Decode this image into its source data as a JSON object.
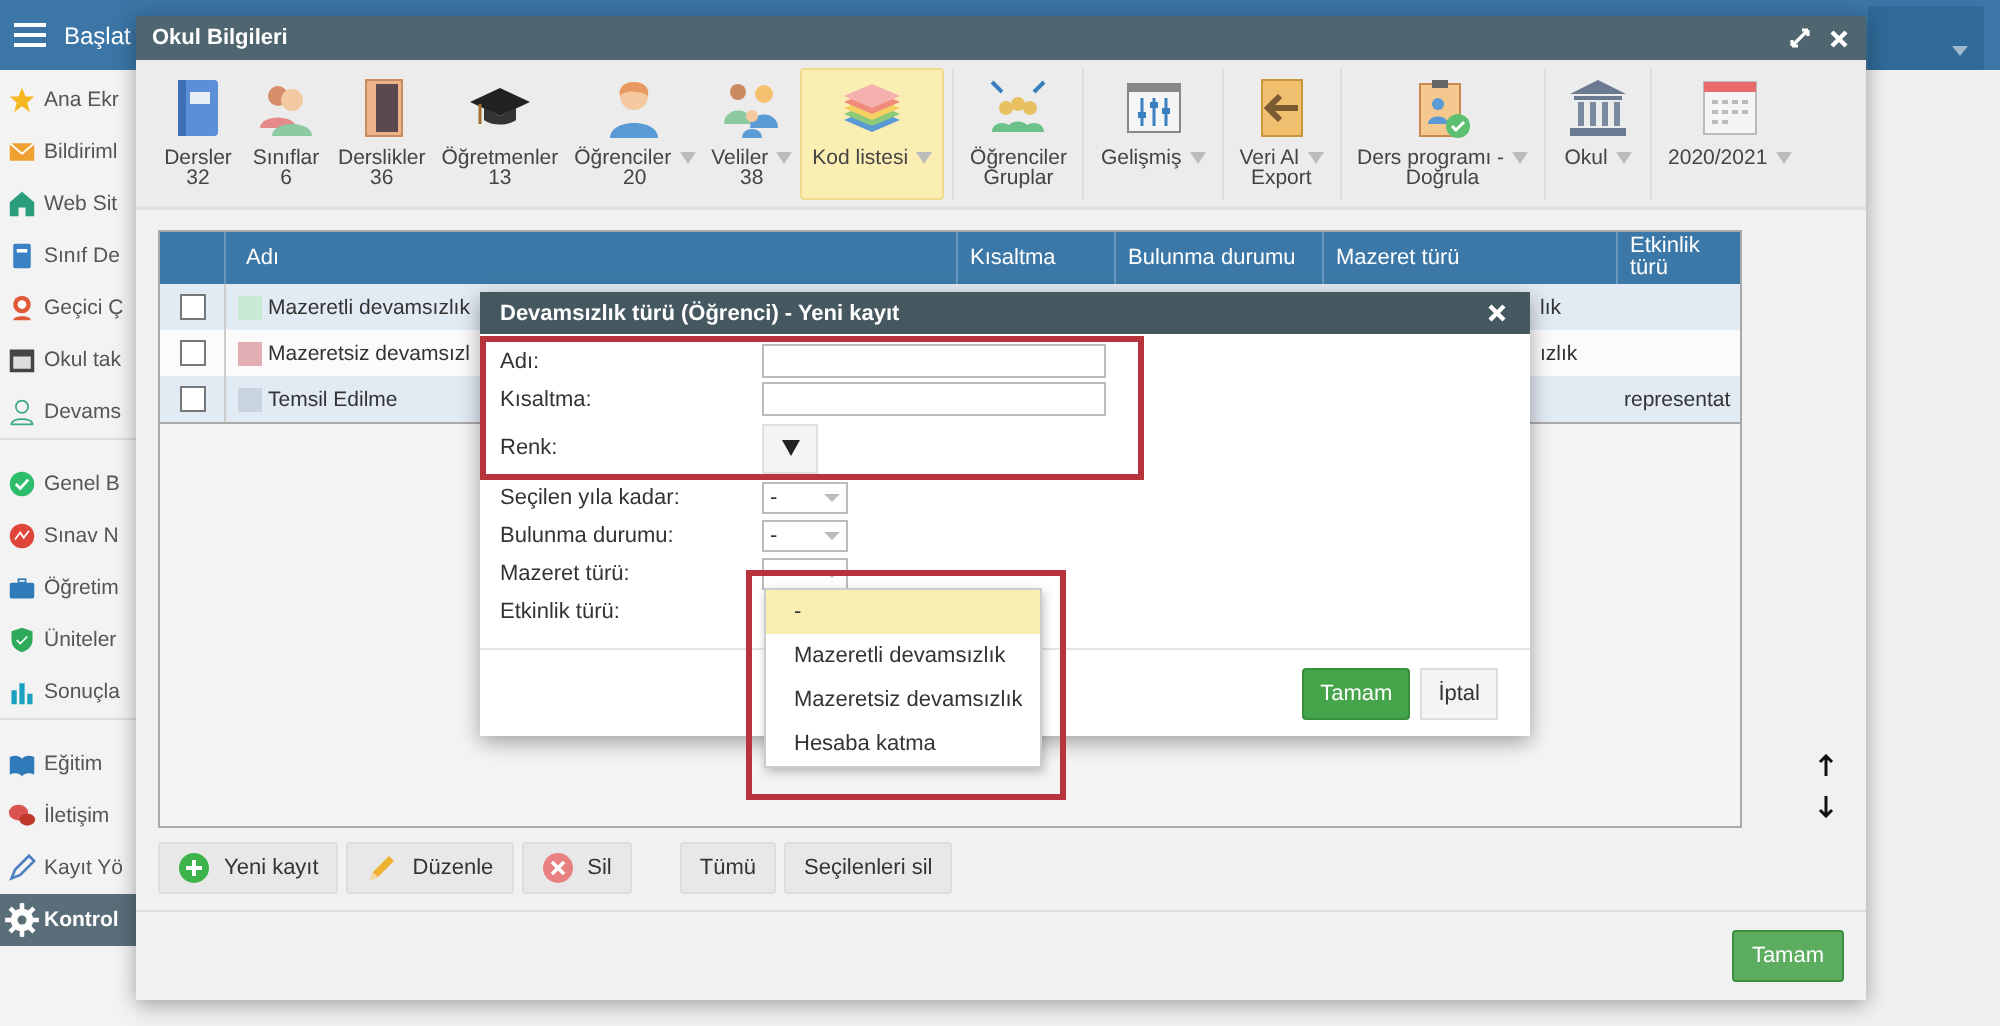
{
  "topbar": {
    "title": "Başlat"
  },
  "sidebar": {
    "groups": [
      [
        {
          "label": "Ana Ekr",
          "selected": false
        },
        {
          "label": "Bildiriml",
          "selected": false
        },
        {
          "label": "Web Sit",
          "selected": false
        },
        {
          "label": "Sınıf De",
          "selected": false
        },
        {
          "label": "Geçici Ç",
          "selected": false
        },
        {
          "label": "Okul tak",
          "selected": false
        },
        {
          "label": "Devams",
          "selected": false
        }
      ],
      [
        {
          "label": "Genel B",
          "selected": false
        },
        {
          "label": "Sınav N",
          "selected": false
        },
        {
          "label": "Öğretim",
          "selected": false
        },
        {
          "label": "Üniteler",
          "selected": false
        },
        {
          "label": "Sonuçla",
          "selected": false
        }
      ],
      [
        {
          "label": "Eğitim",
          "selected": false
        },
        {
          "label": "İletişim",
          "selected": false
        },
        {
          "label": "Kayıt Yö",
          "selected": false
        },
        {
          "label": "Kontrol",
          "selected": true
        }
      ]
    ]
  },
  "window": {
    "title": "Okul Bilgileri"
  },
  "toolbar": {
    "groups": [
      [
        {
          "label": "Dersler",
          "second_line": "32",
          "dropdown": false,
          "selected": false
        },
        {
          "label": "Sınıflar",
          "second_line": "6",
          "dropdown": false,
          "selected": false
        },
        {
          "label": "Derslikler",
          "second_line": "36",
          "dropdown": false,
          "selected": false
        },
        {
          "label": "Öğretmenler",
          "second_line": "13",
          "dropdown": false,
          "selected": false
        },
        {
          "label": "Öğrenciler",
          "second_line": "20",
          "dropdown": true,
          "selected": false
        },
        {
          "label": "Veliler",
          "second_line": "38",
          "dropdown": true,
          "selected": false
        },
        {
          "label": "Kod listesi",
          "dropdown": true,
          "selected": true
        }
      ],
      [
        {
          "label": "Öğrenciler",
          "second_line": "Gruplar",
          "dropdown": false,
          "selected": false
        }
      ],
      [
        {
          "label": "Gelişmiş",
          "dropdown": true,
          "selected": false
        }
      ],
      [
        {
          "label": "Veri Al",
          "second_line": "Export",
          "dropdown": true,
          "selected": false
        }
      ],
      [
        {
          "label": "Ders programı -",
          "second_line": "Doğrula",
          "dropdown": true,
          "selected": false
        }
      ],
      [
        {
          "label": "Okul",
          "dropdown": true,
          "selected": false
        }
      ],
      [
        {
          "label": "2020/2021",
          "dropdown": true,
          "selected": false
        }
      ]
    ]
  },
  "table": {
    "columns": [
      "Adı",
      "Kısaltma",
      "Bulunma durumu",
      "Mazeret türü",
      "Etkinlik türü"
    ],
    "rows": [
      {
        "checked": false,
        "color": "#c8ead4",
        "name": "Mazeretli devamsızlık",
        "mazeret_turu": "lık"
      },
      {
        "checked": false,
        "color": "#e2aeb4",
        "name": "Mazeretsiz devamsızl",
        "mazeret_turu": "ızlık"
      },
      {
        "checked": false,
        "color": "#c8d4de",
        "name": "Temsil Edilme",
        "etkinlik_turu": "representat"
      }
    ]
  },
  "buttons": {
    "edit_actions": [
      "Yeni kayıt",
      "Düzenle",
      "Sil"
    ],
    "selection_actions": [
      "Tümü",
      "Seçilenleri sil"
    ]
  },
  "footer": {
    "ok": "Tamam"
  },
  "dialog": {
    "title": "Devamsızlık türü (Öğrenci) - Yeni kayıt",
    "fields": [
      {
        "label": "Adı:",
        "kind": "text"
      },
      {
        "label": "Kısaltma:",
        "kind": "text"
      },
      {
        "label": "Renk:",
        "kind": "color"
      },
      {
        "label": "Seçilen yıla kadar:",
        "kind": "select",
        "value": "-"
      },
      {
        "label": "Bulunma durumu:",
        "kind": "select",
        "value": "-"
      },
      {
        "label": "Mazeret türü:",
        "kind": "select"
      },
      {
        "label": "Etkinlik türü:",
        "kind": "open_select"
      }
    ],
    "options": [
      {
        "label": "-",
        "selected": true
      },
      {
        "label": "Mazeretli devamsızlık",
        "selected": false
      },
      {
        "label": "Mazeretsiz devamsızlık",
        "selected": false
      },
      {
        "label": "Hesaba katma",
        "selected": false
      }
    ],
    "ok": "Tamam",
    "cancel": "İptal"
  }
}
